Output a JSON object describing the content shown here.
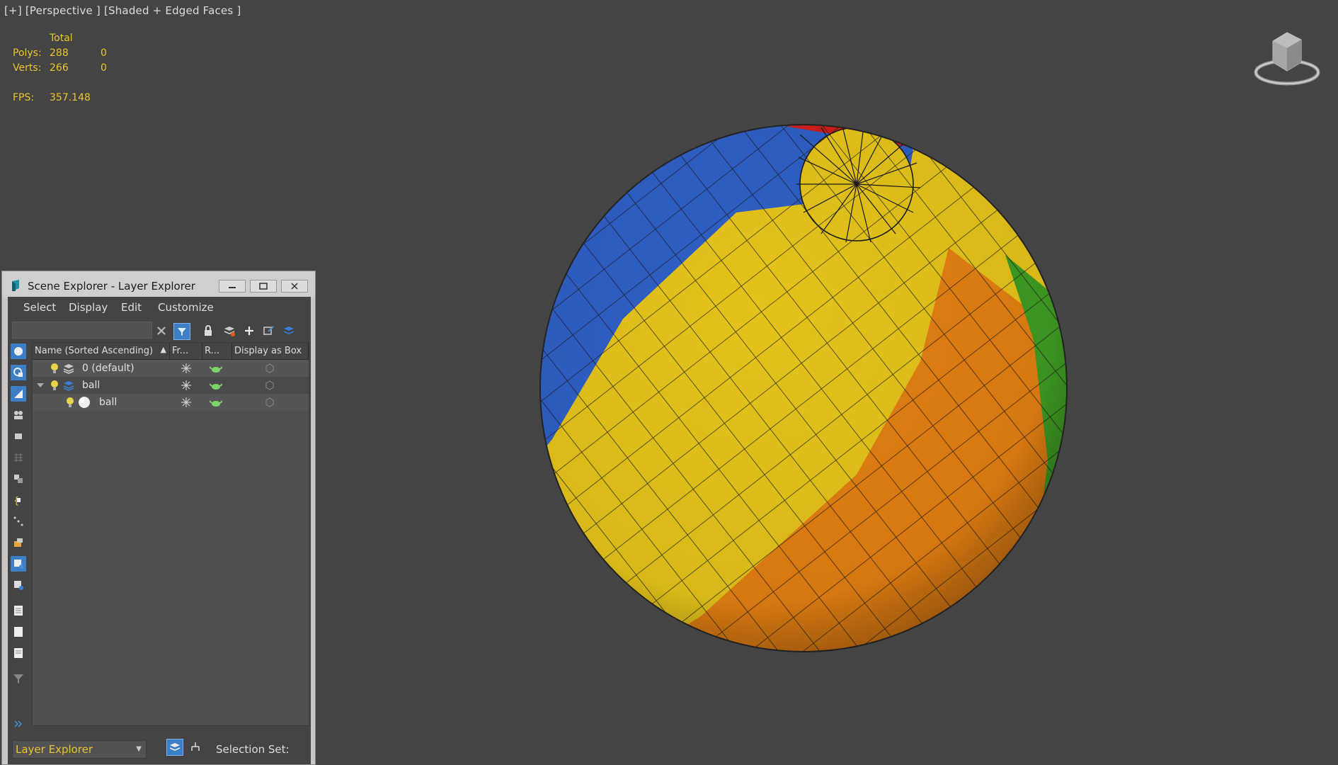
{
  "viewport": {
    "label": "[+] [Perspective ] [Shaded + Edged Faces ]"
  },
  "stats": {
    "header": "Total",
    "polys_label": "Polys:",
    "polys_total": "288",
    "polys_sel": "0",
    "verts_label": "Verts:",
    "verts_total": "266",
    "verts_sel": "0",
    "fps_label": "FPS:",
    "fps_value": "357.148"
  },
  "explorer": {
    "title": "Scene Explorer - Layer Explorer",
    "menu": [
      "Select",
      "Display",
      "Edit",
      "Customize"
    ],
    "search_placeholder": "",
    "columns": [
      "Name (Sorted Ascending)",
      "Fr...",
      "R...",
      "Display as Box"
    ],
    "rows": [
      {
        "name": "0 (default)"
      },
      {
        "name": "ball"
      },
      {
        "name": "ball"
      }
    ],
    "explorer_mode": "Layer Explorer",
    "selection_set_label": "Selection Set:"
  },
  "colors": {
    "accent_yellow": "#e8c531",
    "ball_blue": "#2f5fc4",
    "ball_yellow": "#e3c21a",
    "ball_orange": "#e17e12",
    "ball_green": "#3e9a22",
    "ball_red": "#cc1e1a"
  }
}
